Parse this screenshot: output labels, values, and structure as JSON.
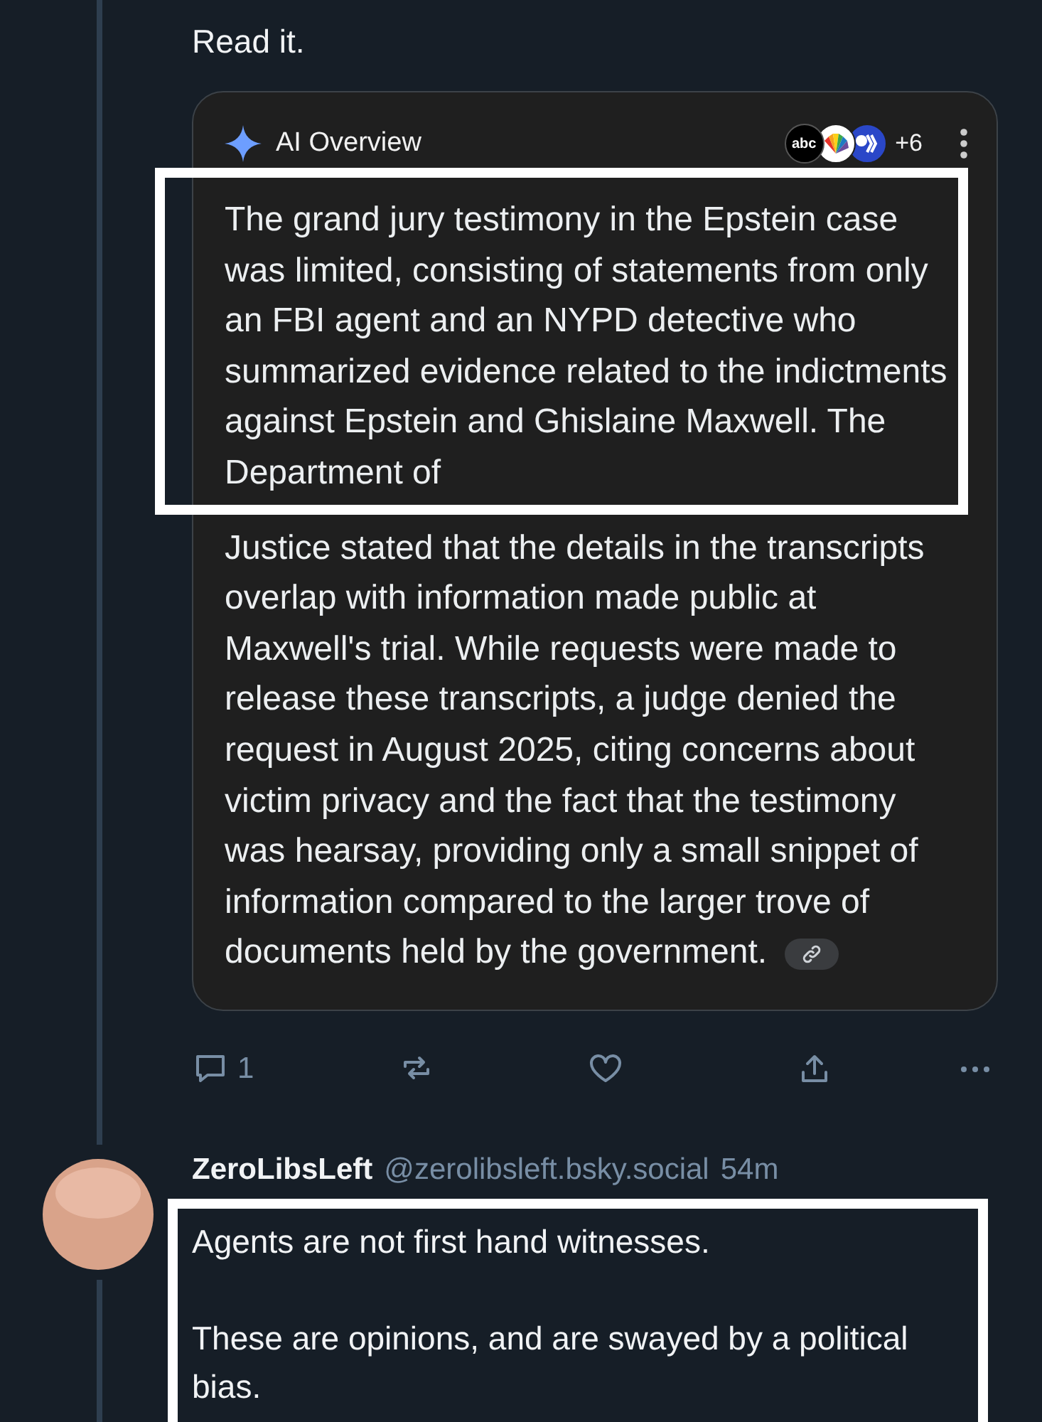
{
  "post": {
    "text": "Read it.",
    "overview": {
      "title": "AI Overview",
      "sources": [
        {
          "kind": "lettered",
          "label": "abc"
        },
        {
          "kind": "fan"
        },
        {
          "kind": "profile"
        }
      ],
      "more_sources": "+6",
      "highlighted_text": "The grand jury testimony in the Epstein case was limited, consisting of statements from only an FBI agent and an NYPD detective who summarized evidence related to the indictments against Epstein and Ghislaine Maxwell. The Department of",
      "text": "Justice stated that the details in the transcripts overlap with information made public at Maxwell's trial. While requests were made to release these transcripts, a judge denied the request in August 2025, citing concerns about victim privacy and the fact that the testimony was hearsay, providing only a small snippet of information compared to the larger trove of documents held by the government."
    },
    "actions": [
      {
        "kind": "reply",
        "count": "1"
      },
      {
        "kind": "repost"
      },
      {
        "kind": "like"
      },
      {
        "kind": "share"
      },
      {
        "kind": "more"
      }
    ]
  },
  "reply": {
    "display_name": "ZeroLibsLeft",
    "handle": "@zerolibsleft.bsky.social",
    "time": "54m",
    "paragraphs": [
      "Agents are not first hand witnesses.",
      "These are opinions, and are swayed by a political bias."
    ]
  }
}
